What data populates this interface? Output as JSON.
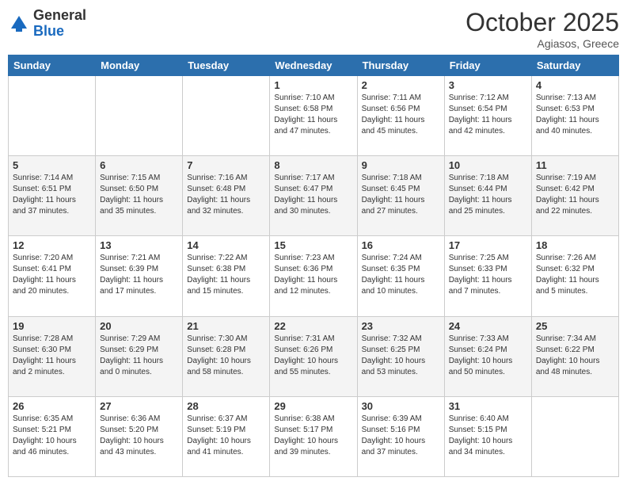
{
  "logo": {
    "general": "General",
    "blue": "Blue"
  },
  "header": {
    "title": "October 2025",
    "subtitle": "Agiasos, Greece"
  },
  "days_of_week": [
    "Sunday",
    "Monday",
    "Tuesday",
    "Wednesday",
    "Thursday",
    "Friday",
    "Saturday"
  ],
  "weeks": [
    [
      {
        "day": "",
        "info": ""
      },
      {
        "day": "",
        "info": ""
      },
      {
        "day": "",
        "info": ""
      },
      {
        "day": "1",
        "info": "Sunrise: 7:10 AM\nSunset: 6:58 PM\nDaylight: 11 hours and 47 minutes."
      },
      {
        "day": "2",
        "info": "Sunrise: 7:11 AM\nSunset: 6:56 PM\nDaylight: 11 hours and 45 minutes."
      },
      {
        "day": "3",
        "info": "Sunrise: 7:12 AM\nSunset: 6:54 PM\nDaylight: 11 hours and 42 minutes."
      },
      {
        "day": "4",
        "info": "Sunrise: 7:13 AM\nSunset: 6:53 PM\nDaylight: 11 hours and 40 minutes."
      }
    ],
    [
      {
        "day": "5",
        "info": "Sunrise: 7:14 AM\nSunset: 6:51 PM\nDaylight: 11 hours and 37 minutes."
      },
      {
        "day": "6",
        "info": "Sunrise: 7:15 AM\nSunset: 6:50 PM\nDaylight: 11 hours and 35 minutes."
      },
      {
        "day": "7",
        "info": "Sunrise: 7:16 AM\nSunset: 6:48 PM\nDaylight: 11 hours and 32 minutes."
      },
      {
        "day": "8",
        "info": "Sunrise: 7:17 AM\nSunset: 6:47 PM\nDaylight: 11 hours and 30 minutes."
      },
      {
        "day": "9",
        "info": "Sunrise: 7:18 AM\nSunset: 6:45 PM\nDaylight: 11 hours and 27 minutes."
      },
      {
        "day": "10",
        "info": "Sunrise: 7:18 AM\nSunset: 6:44 PM\nDaylight: 11 hours and 25 minutes."
      },
      {
        "day": "11",
        "info": "Sunrise: 7:19 AM\nSunset: 6:42 PM\nDaylight: 11 hours and 22 minutes."
      }
    ],
    [
      {
        "day": "12",
        "info": "Sunrise: 7:20 AM\nSunset: 6:41 PM\nDaylight: 11 hours and 20 minutes."
      },
      {
        "day": "13",
        "info": "Sunrise: 7:21 AM\nSunset: 6:39 PM\nDaylight: 11 hours and 17 minutes."
      },
      {
        "day": "14",
        "info": "Sunrise: 7:22 AM\nSunset: 6:38 PM\nDaylight: 11 hours and 15 minutes."
      },
      {
        "day": "15",
        "info": "Sunrise: 7:23 AM\nSunset: 6:36 PM\nDaylight: 11 hours and 12 minutes."
      },
      {
        "day": "16",
        "info": "Sunrise: 7:24 AM\nSunset: 6:35 PM\nDaylight: 11 hours and 10 minutes."
      },
      {
        "day": "17",
        "info": "Sunrise: 7:25 AM\nSunset: 6:33 PM\nDaylight: 11 hours and 7 minutes."
      },
      {
        "day": "18",
        "info": "Sunrise: 7:26 AM\nSunset: 6:32 PM\nDaylight: 11 hours and 5 minutes."
      }
    ],
    [
      {
        "day": "19",
        "info": "Sunrise: 7:28 AM\nSunset: 6:30 PM\nDaylight: 11 hours and 2 minutes."
      },
      {
        "day": "20",
        "info": "Sunrise: 7:29 AM\nSunset: 6:29 PM\nDaylight: 11 hours and 0 minutes."
      },
      {
        "day": "21",
        "info": "Sunrise: 7:30 AM\nSunset: 6:28 PM\nDaylight: 10 hours and 58 minutes."
      },
      {
        "day": "22",
        "info": "Sunrise: 7:31 AM\nSunset: 6:26 PM\nDaylight: 10 hours and 55 minutes."
      },
      {
        "day": "23",
        "info": "Sunrise: 7:32 AM\nSunset: 6:25 PM\nDaylight: 10 hours and 53 minutes."
      },
      {
        "day": "24",
        "info": "Sunrise: 7:33 AM\nSunset: 6:24 PM\nDaylight: 10 hours and 50 minutes."
      },
      {
        "day": "25",
        "info": "Sunrise: 7:34 AM\nSunset: 6:22 PM\nDaylight: 10 hours and 48 minutes."
      }
    ],
    [
      {
        "day": "26",
        "info": "Sunrise: 6:35 AM\nSunset: 5:21 PM\nDaylight: 10 hours and 46 minutes."
      },
      {
        "day": "27",
        "info": "Sunrise: 6:36 AM\nSunset: 5:20 PM\nDaylight: 10 hours and 43 minutes."
      },
      {
        "day": "28",
        "info": "Sunrise: 6:37 AM\nSunset: 5:19 PM\nDaylight: 10 hours and 41 minutes."
      },
      {
        "day": "29",
        "info": "Sunrise: 6:38 AM\nSunset: 5:17 PM\nDaylight: 10 hours and 39 minutes."
      },
      {
        "day": "30",
        "info": "Sunrise: 6:39 AM\nSunset: 5:16 PM\nDaylight: 10 hours and 37 minutes."
      },
      {
        "day": "31",
        "info": "Sunrise: 6:40 AM\nSunset: 5:15 PM\nDaylight: 10 hours and 34 minutes."
      },
      {
        "day": "",
        "info": ""
      }
    ]
  ]
}
